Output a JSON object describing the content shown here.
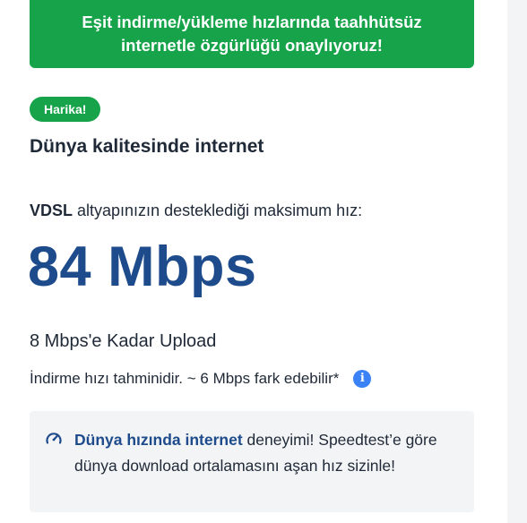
{
  "banner": {
    "line1": "Eşit indirme/yükleme hızlarında taahhütsüz",
    "line2": "internetle özgürlüğü onaylıyoruz!"
  },
  "badge": "Harika!",
  "headline": "Dünya kalitesinde internet",
  "max_speed": {
    "tech": "VDSL",
    "text": " altyapınızın desteklediği maksimum hız:",
    "value": "84 Mbps"
  },
  "upload": "8 Mbps'e Kadar Upload",
  "estimate": {
    "text": "İndirme hızı tahminidir. ~ 6 Mbps fark edebilir*",
    "icon": "info-icon"
  },
  "note": {
    "icon": "speedometer-icon",
    "bold": "Dünya hızında internet",
    "text": " deneyimi! Speedtest’e göre dünya download ortalamasını aşan hız sizinle!"
  },
  "colors": {
    "green": "#16a34a",
    "navy": "#1e4b8c",
    "info_blue": "#3b82f6"
  }
}
